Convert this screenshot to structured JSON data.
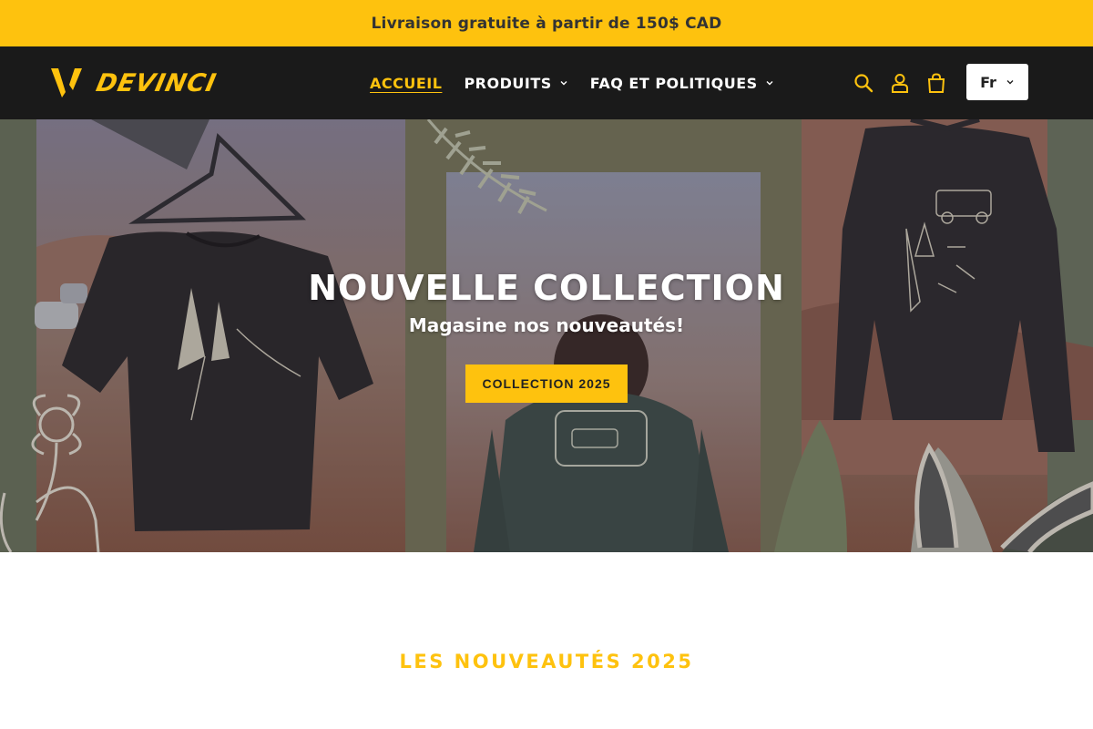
{
  "announcement": {
    "text": "Livraison gratuite à partir de 150$ CAD"
  },
  "brand": {
    "name": "DEVINCI",
    "color": "#fec20e"
  },
  "nav": {
    "items": [
      {
        "label": "ACCUEIL",
        "active": true,
        "has_dropdown": false
      },
      {
        "label": "PRODUITS",
        "active": false,
        "has_dropdown": true
      },
      {
        "label": "FAQ ET POLITIQUES",
        "active": false,
        "has_dropdown": true
      }
    ]
  },
  "tools": {
    "icons": [
      "search-icon",
      "account-icon",
      "cart-icon"
    ],
    "language": "Fr"
  },
  "hero": {
    "title": "NOUVELLE COLLECTION",
    "subtitle": "Magasine nos nouveautés!",
    "cta_label": "COLLECTION 2025"
  },
  "section": {
    "title": "LES NOUVEAUTÉS 2025"
  }
}
